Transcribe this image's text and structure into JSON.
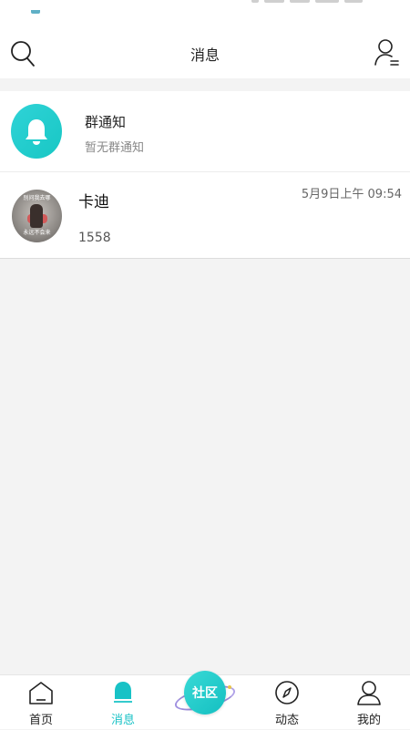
{
  "header": {
    "title": "消息",
    "left_icon": "search-icon",
    "right_icon": "user-list-icon"
  },
  "group_notice": {
    "title": "群通知",
    "subtitle": "暂无群通知",
    "icon": "bell-icon"
  },
  "conversations": [
    {
      "name": "卡迪",
      "time": "5月9日上午 09:54",
      "last_message": "1558",
      "avatar_caption_top": "别问我去哪",
      "avatar_caption_bottom": "永远不会来"
    }
  ],
  "tabbar": {
    "items": [
      {
        "label": "首页",
        "icon": "home-icon",
        "active": false
      },
      {
        "label": "消息",
        "icon": "bell-icon",
        "active": true
      },
      {
        "label": "社区",
        "icon": "planet-icon",
        "active": false
      },
      {
        "label": "动态",
        "icon": "compass-icon",
        "active": false
      },
      {
        "label": "我的",
        "icon": "person-icon",
        "active": false
      }
    ]
  },
  "colors": {
    "accent": "#18c2c6",
    "background": "#f3f3f3",
    "ring": "#9a8ad6"
  }
}
